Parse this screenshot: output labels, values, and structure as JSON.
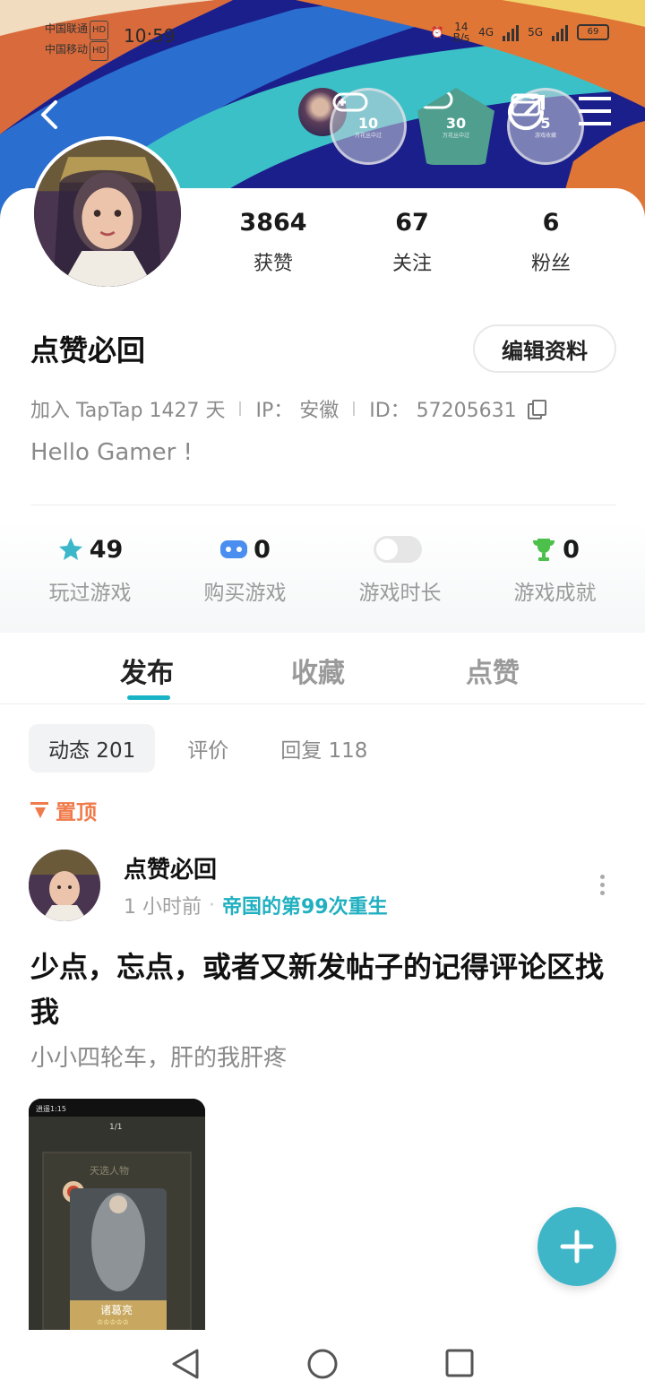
{
  "status_bar": {
    "carrier1": "中国联通",
    "carrier2": "中国移动",
    "hd": "HD",
    "time": "10:59",
    "speed": "14",
    "speed_unit": "B/s",
    "net1": "4G",
    "net2": "5G",
    "battery": "69"
  },
  "badges": [
    {
      "num": "10",
      "sub": "万花丛中过"
    },
    {
      "num": "30",
      "sub": "万花丛中过"
    },
    {
      "num": "5",
      "sub": "游戏收藏"
    }
  ],
  "profile": {
    "stats": [
      {
        "value": "3864",
        "label": "获赞"
      },
      {
        "value": "67",
        "label": "关注"
      },
      {
        "value": "6",
        "label": "粉丝"
      }
    ],
    "name": "点赞必回",
    "edit_label": "编辑资料",
    "join": "加入 TapTap 1427 天",
    "ip": "IP： 安徽",
    "id": "ID： 57205631",
    "bio": "Hello Gamer !"
  },
  "game_stats": [
    {
      "value": "49",
      "label": "玩过游戏",
      "icon": "star-icon"
    },
    {
      "value": "0",
      "label": "购买游戏",
      "icon": "gamepad-icon"
    },
    {
      "value": "",
      "label": "游戏时长",
      "icon": "toggle"
    },
    {
      "value": "0",
      "label": "游戏成就",
      "icon": "trophy-icon"
    }
  ],
  "tabs": [
    "发布",
    "收藏",
    "点赞"
  ],
  "subtabs": [
    "动态 201",
    "评价",
    "回复 118"
  ],
  "pinned_label": "置顶",
  "post": {
    "author": "点赞必回",
    "time": "1 小时前",
    "game": "帝国的第99次重生",
    "title": "少点，忘点，或者又新发帖子的记得评论区找我",
    "body": "小小四轮车，肝的我肝疼",
    "image_text": {
      "status_time": "逍遥1:15",
      "page": "1/1",
      "card_title": "天选人物",
      "hero": "诸葛亮"
    }
  },
  "colors": {
    "accent": "#18b4c6",
    "fab": "#3fb6c8",
    "pin": "#f07a4a",
    "game_link": "#20b0c0"
  }
}
